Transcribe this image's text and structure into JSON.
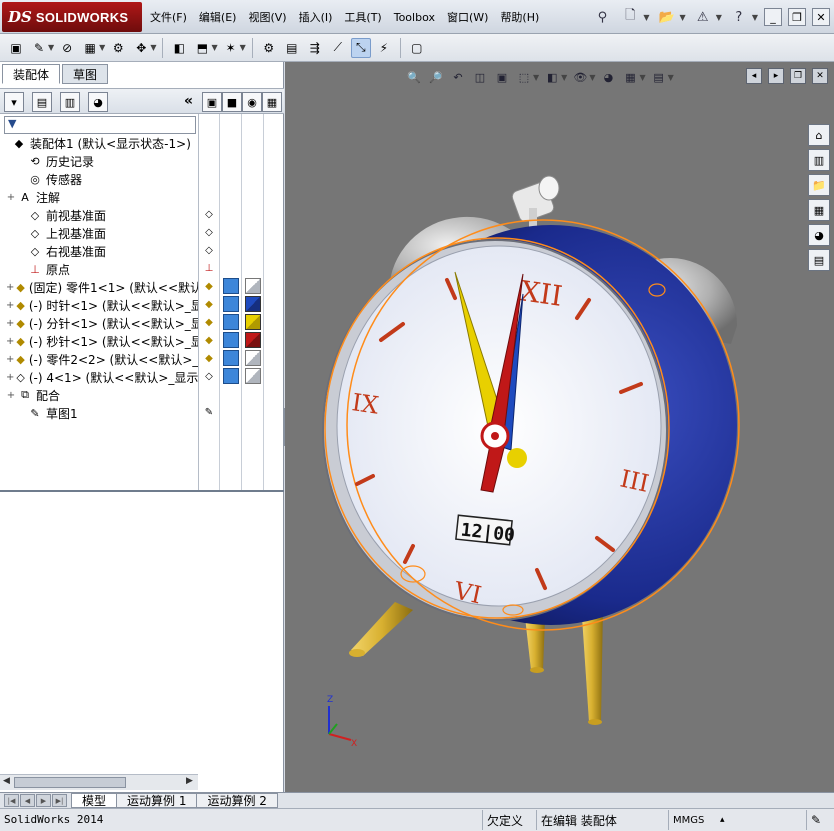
{
  "app": {
    "brand_mark": "DS",
    "brand_name": "SOLIDWORKS",
    "version_text": "SolidWorks 2014"
  },
  "menu": [
    {
      "label": "文件(F)"
    },
    {
      "label": "编辑(E)"
    },
    {
      "label": "视图(V)"
    },
    {
      "label": "插入(I)"
    },
    {
      "label": "工具(T)"
    },
    {
      "label": "Toolbox"
    },
    {
      "label": "窗口(W)"
    },
    {
      "label": "帮助(H)"
    }
  ],
  "panel_tabs": [
    {
      "label": "装配体",
      "active": true
    },
    {
      "label": "草图",
      "active": false
    }
  ],
  "tree": [
    {
      "label": "装配体1  (默认<显示状态-1>)",
      "icon": "assembly-icon",
      "expander": ""
    },
    {
      "label": "历史记录",
      "icon": "history-icon",
      "expander": ""
    },
    {
      "label": "传感器",
      "icon": "sensor-icon",
      "expander": ""
    },
    {
      "label": "注解",
      "icon": "annotation-icon",
      "expander": "+"
    },
    {
      "label": "前视基准面",
      "icon": "plane-icon",
      "expander": ""
    },
    {
      "label": "上视基准面",
      "icon": "plane-icon",
      "expander": ""
    },
    {
      "label": "右视基准面",
      "icon": "plane-icon",
      "expander": ""
    },
    {
      "label": "原点",
      "icon": "origin-icon",
      "expander": ""
    },
    {
      "label": "(固定) 零件1<1> (默认<<默认",
      "icon": "part-icon",
      "expander": "+"
    },
    {
      "label": "(-) 时针<1> (默认<<默认>_显",
      "icon": "part-icon",
      "expander": "+"
    },
    {
      "label": "(-) 分针<1> (默认<<默认>_显",
      "icon": "part-icon",
      "expander": "+"
    },
    {
      "label": "(-) 秒针<1> (默认<<默认>_显",
      "icon": "part-icon",
      "expander": "+"
    },
    {
      "label": "(-) 零件2<2> (默认<<默认>_",
      "icon": "part-icon",
      "expander": "+"
    },
    {
      "label": "(-) 4<1> (默认<<默认>_显示",
      "icon": "part-outline-icon",
      "expander": "+"
    },
    {
      "label": "配合",
      "icon": "mates-icon",
      "expander": "+"
    },
    {
      "label": "草图1",
      "icon": "sketch-icon",
      "expander": ""
    }
  ],
  "bottom_tabs": [
    {
      "label": "模型",
      "active": true
    },
    {
      "label": "运动算例 1",
      "active": false
    },
    {
      "label": "运动算例 2",
      "active": false
    }
  ],
  "status": {
    "definition": "欠定义",
    "editing": "在编辑 装配体",
    "units": "MMGS",
    "units_caret": "▴"
  },
  "clock": {
    "numerals": [
      "XII",
      "III",
      "VI",
      "IX"
    ],
    "digital_display": "12|00"
  },
  "colors": {
    "viewport_bg": "#767676",
    "clock_body": "#1a2a8c",
    "bell": "#b8b8b8",
    "legs": "#d8b030",
    "selection": "#ff8c1a",
    "face": "#eef1fa",
    "hour_hand": "#e8d000",
    "minute_hand": "#1f4bbf",
    "second_hand": "#c01818"
  }
}
